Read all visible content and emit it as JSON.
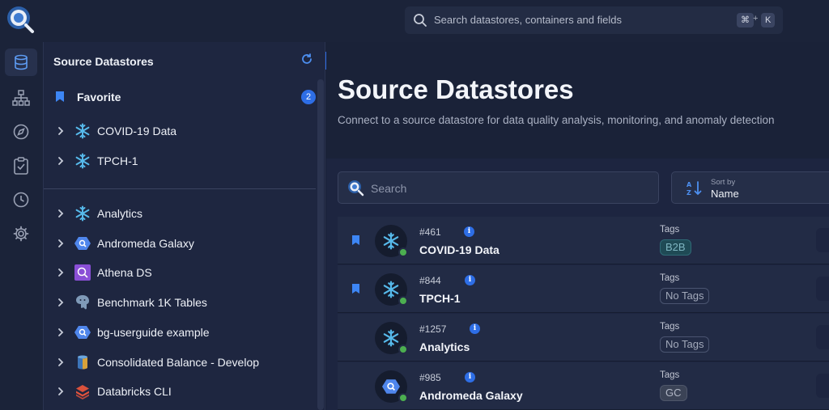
{
  "topbar": {
    "search_placeholder": "Search datastores, containers and fields",
    "shortcut_key1": "⌘",
    "shortcut_plus": "+",
    "shortcut_key2": "K"
  },
  "rail": {
    "items": [
      "datastores",
      "explore-tree",
      "discover",
      "checks",
      "history",
      "settings"
    ]
  },
  "tree": {
    "title": "Source Datastores",
    "favorite_label": "Favorite",
    "favorite_count": "2",
    "favorites": [
      {
        "label": "COVID-19 Data",
        "icon": "snowflake-icon"
      },
      {
        "label": "TPCH-1",
        "icon": "snowflake-icon"
      }
    ],
    "items": [
      {
        "label": "Analytics",
        "icon": "snowflake-icon"
      },
      {
        "label": "Andromeda Galaxy",
        "icon": "bigquery-icon"
      },
      {
        "label": "Athena DS",
        "icon": "athena-icon"
      },
      {
        "label": "Benchmark 1K Tables",
        "icon": "postgres-icon"
      },
      {
        "label": "bg-userguide example",
        "icon": "bigquery-icon"
      },
      {
        "label": "Consolidated Balance - Develop",
        "icon": "redshift-icon"
      },
      {
        "label": "Databricks CLI",
        "icon": "databricks-icon"
      }
    ]
  },
  "main": {
    "title": "Source Datastores",
    "subtitle": "Connect to a source datastore for data quality analysis, monitoring, and anomaly detection",
    "search_placeholder": "Search",
    "sort_caption": "Sort by",
    "sort_value": "Name",
    "tags_label": "Tags",
    "rows": [
      {
        "id": "#461",
        "name": "COVID-19 Data",
        "tag": "B2B",
        "bookmarked": true,
        "icon": "snowflake-icon"
      },
      {
        "id": "#844",
        "name": "TPCH-1",
        "tag": "No Tags",
        "bookmarked": true,
        "icon": "snowflake-icon"
      },
      {
        "id": "#1257",
        "name": "Analytics",
        "tag": "No Tags",
        "bookmarked": false,
        "icon": "snowflake-icon"
      },
      {
        "id": "#985",
        "name": "Andromeda Galaxy",
        "tag": "GC",
        "bookmarked": false,
        "icon": "bigquery-icon"
      }
    ]
  },
  "colors": {
    "accent": "#2e6ee6",
    "status_ok": "#4caf50",
    "snowflake": "#56b9ea"
  }
}
